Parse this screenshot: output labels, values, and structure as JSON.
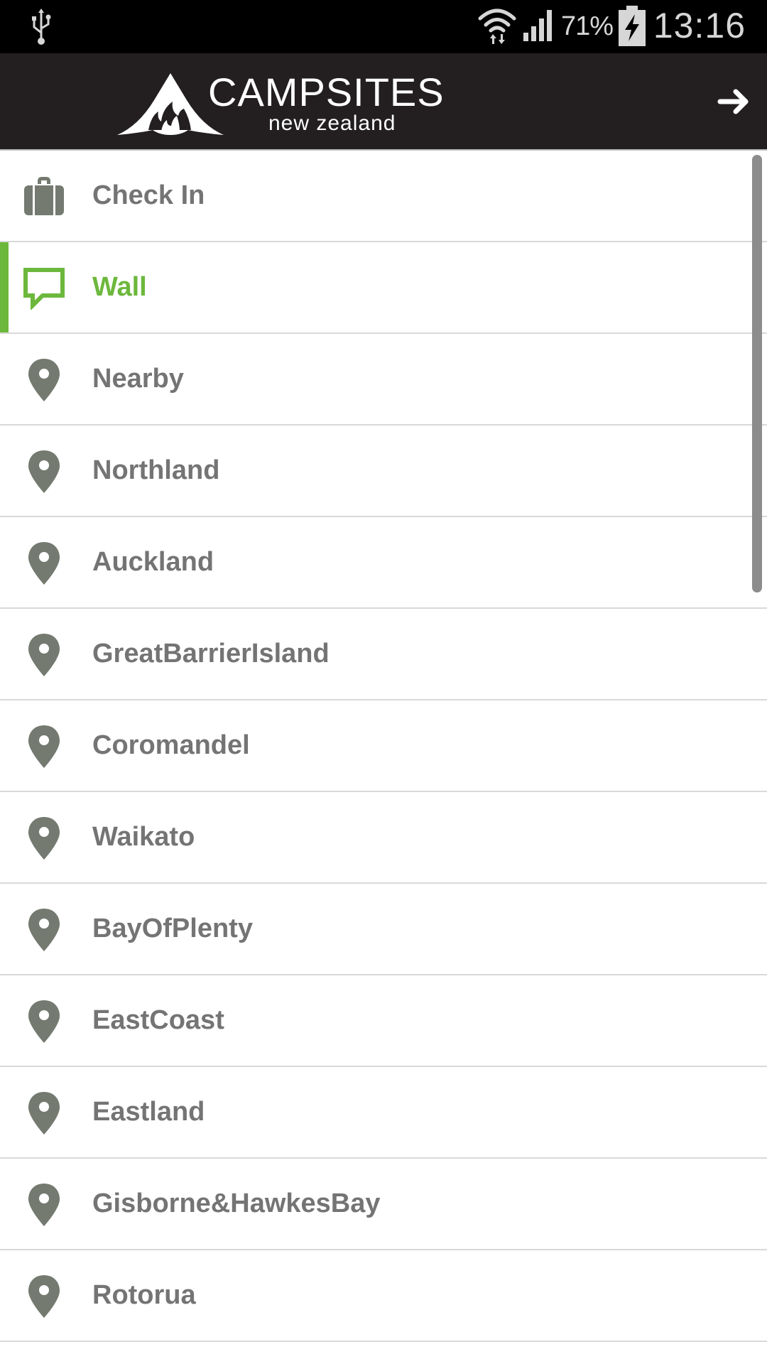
{
  "status_bar": {
    "battery_percent": "71%",
    "time": "13:16",
    "icons": [
      "usb-icon",
      "wifi-icon",
      "signal-icon",
      "battery-charging-icon"
    ]
  },
  "app_bar": {
    "logo_title": "CAMPSITES",
    "logo_subtitle": "new zealand",
    "forward_icon": "arrow-right-icon"
  },
  "menu": {
    "active_index": 1,
    "items": [
      {
        "label": "Check In",
        "icon": "briefcase-icon"
      },
      {
        "label": "Wall",
        "icon": "speech-bubble-icon"
      },
      {
        "label": "Nearby",
        "icon": "map-pin-icon"
      },
      {
        "label": "Northland",
        "icon": "map-pin-icon"
      },
      {
        "label": "Auckland",
        "icon": "map-pin-icon"
      },
      {
        "label": "GreatBarrierIsland",
        "icon": "map-pin-icon"
      },
      {
        "label": "Coromandel",
        "icon": "map-pin-icon"
      },
      {
        "label": "Waikato",
        "icon": "map-pin-icon"
      },
      {
        "label": "BayOfPlenty",
        "icon": "map-pin-icon"
      },
      {
        "label": "EastCoast",
        "icon": "map-pin-icon"
      },
      {
        "label": "Eastland",
        "icon": "map-pin-icon"
      },
      {
        "label": "Gisborne&HawkesBay",
        "icon": "map-pin-icon"
      },
      {
        "label": "Rotorua",
        "icon": "map-pin-icon"
      }
    ]
  },
  "colors": {
    "accent": "#6cb83c",
    "app_bar_bg": "#231f20",
    "status_bar_bg": "#000000",
    "item_text": "#747474",
    "icon_gray": "#747a70"
  }
}
